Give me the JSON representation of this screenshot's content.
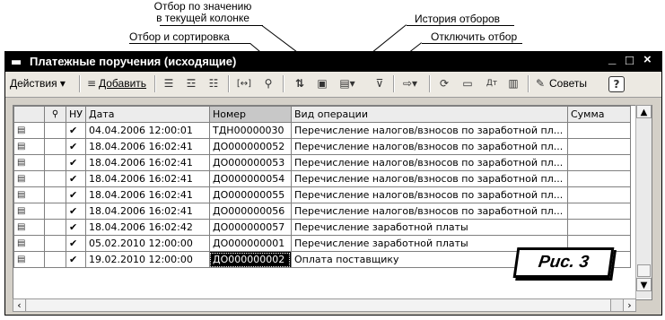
{
  "annotations": {
    "filter_by_value": [
      "Отбор по значению",
      "в текущей колонке"
    ],
    "filter_and_sort": "Отбор и сортировка",
    "filter_history": "История отборов",
    "disable_filter": "Отключить отбор"
  },
  "window": {
    "title": "Платежные поручения (исходящие)",
    "minimize": "_",
    "maximize": "□",
    "close": "×"
  },
  "toolbar": {
    "actions_label": "Действия ▾",
    "add_label": "Добавить",
    "tips_label": "Советы",
    "help_label": "?"
  },
  "table": {
    "columns": [
      "",
      "",
      "НУ",
      "Дата",
      "Номер",
      "Вид операции",
      "Сумма"
    ],
    "rows": [
      {
        "nu": "✔",
        "date": "04.04.2006 12:00:01",
        "number": "ТДН00000030",
        "operation": "Перечисление налогов/взносов по заработной пл...",
        "sum": ""
      },
      {
        "nu": "✔",
        "date": "18.04.2006 16:02:41",
        "number": "ДО000000052",
        "operation": "Перечисление налогов/взносов по заработной пл...",
        "sum": ""
      },
      {
        "nu": "✔",
        "date": "18.04.2006 16:02:41",
        "number": "ДО000000053",
        "operation": "Перечисление налогов/взносов по заработной пл...",
        "sum": ""
      },
      {
        "nu": "✔",
        "date": "18.04.2006 16:02:41",
        "number": "ДО000000054",
        "operation": "Перечисление налогов/взносов по заработной пл...",
        "sum": ""
      },
      {
        "nu": "✔",
        "date": "18.04.2006 16:02:41",
        "number": "ДО000000055",
        "operation": "Перечисление налогов/взносов по заработной пл...",
        "sum": ""
      },
      {
        "nu": "✔",
        "date": "18.04.2006 16:02:41",
        "number": "ДО000000056",
        "operation": "Перечисление налогов/взносов по заработной пл...",
        "sum": ""
      },
      {
        "nu": "✔",
        "date": "18.04.2006 16:02:42",
        "number": "ДО000000057",
        "operation": "Перечисление заработной платы",
        "sum": ""
      },
      {
        "nu": "✔",
        "date": "05.02.2010 12:00:00",
        "number": "ДО000000001",
        "operation": "Перечисление заработной платы",
        "sum": ""
      },
      {
        "nu": "✔",
        "date": "19.02.2010 12:00:00",
        "number": "ДО000000002",
        "operation": "Оплата поставщику",
        "sum": ""
      }
    ]
  },
  "figure_label": "Рис. 3"
}
